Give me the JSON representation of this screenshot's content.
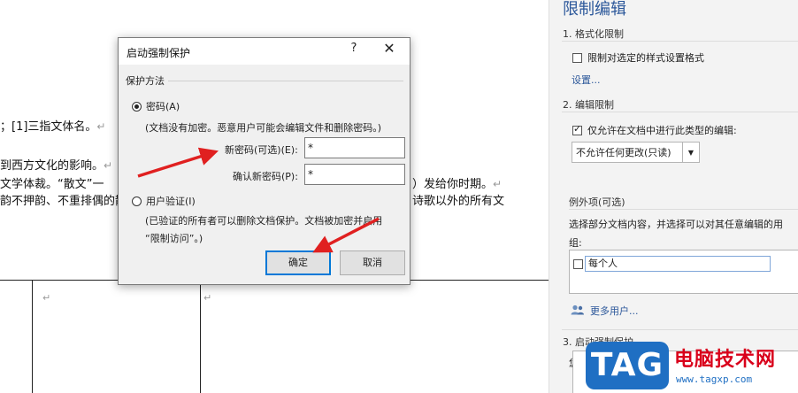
{
  "document": {
    "lines": [
      "；[1]三指文体名。",
      "到西方文化的影响。",
      "文学体裁。“散文”一",
      "韵不押韵、不重排偶的散",
      "）发给你时期。",
      "诗歌以外的所有文"
    ]
  },
  "pane": {
    "title": "限制编辑",
    "format": {
      "heading": "1. 格式化限制",
      "checkbox_label": "限制对选定的样式设置格式",
      "settings_link": "设置..."
    },
    "editing": {
      "heading": "2. 编辑限制",
      "checkbox_label": "仅允许在文档中进行此类型的编辑:",
      "dropdown_value": "不允许任何更改(只读)"
    },
    "exceptions": {
      "heading": "例外项(可选)",
      "desc_line1": "选择部分文档内容，并选择可以对其任意编辑的用",
      "desc_line2": "组:",
      "group_item": "每个人",
      "more_users": "更多用户..."
    },
    "enforce": {
      "heading": "3. 启动强制保护",
      "partial_text": "您"
    }
  },
  "watermark": {
    "tag": "TAG",
    "cn": "电脑技术网",
    "url": "www.tagxp.com"
  },
  "dialog": {
    "title": "启动强制保护",
    "help": "?",
    "close": "✕",
    "group_label": "保护方法",
    "password_option": "密码(A)",
    "password_note": "(文档没有加密。恶意用户可能会编辑文件和删除密码。)",
    "new_password_label": "新密码(可选)(E):",
    "new_password_value": "*",
    "confirm_password_label": "确认新密码(P):",
    "confirm_password_value": "*",
    "user_auth_option": "用户验证(I)",
    "user_auth_note_line1": "(已验证的所有者可以删除文档保护。文档被加密并启用",
    "user_auth_note_line2": "“限制访问”。)",
    "ok": "确定",
    "cancel": "取消"
  },
  "colors": {
    "pane_title": "#2b579a",
    "link": "#2b579a",
    "primary_button_border": "#0078d7",
    "annotation_arrow": "#e02020",
    "watermark_blue": "#1f6fc3",
    "watermark_red": "#d9001b"
  }
}
